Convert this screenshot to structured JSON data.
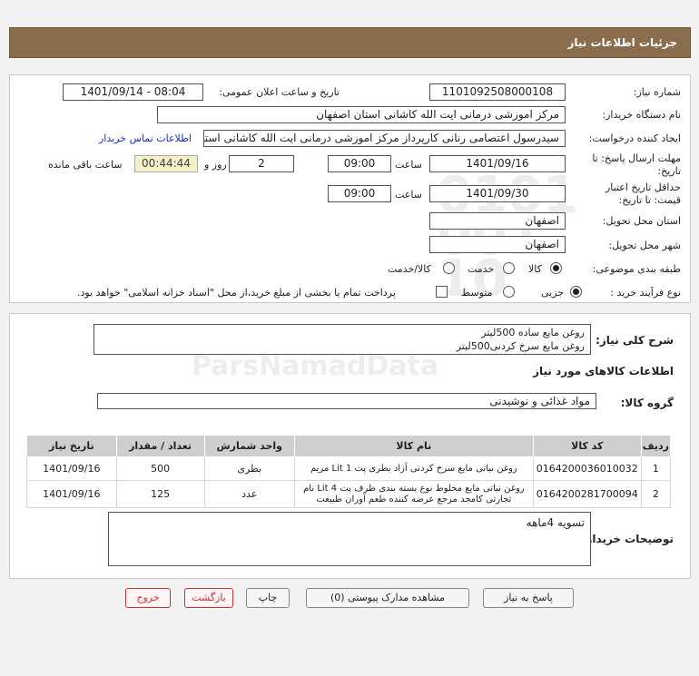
{
  "header": {
    "title": "جزئیات اطلاعات نیاز"
  },
  "form": {
    "need_number_label": "شماره نیاز:",
    "need_number": "1101092508000108",
    "announce_label": "تاریخ و ساعت اعلان عمومی:",
    "announce_value": "1401/09/14 - 08:04",
    "buyer_label": "نام دستگاه خریدار:",
    "buyer_value": "مرکز اموزشی درمانی ایت الله کاشانی استان اصفهان",
    "creator_label": "ایجاد کننده درخواست:",
    "creator_value": "سیدرسول اعتصامی رنانی کارپرداز مرکز اموزشی درمانی ایت الله کاشانی استان",
    "contact_link": "اطلاعات تماس خریدار",
    "deadline_label_1": "مهلت ارسال پاسخ: تا",
    "deadline_label_2": "تاریخ:",
    "deadline_date": "1401/09/16",
    "time_label": "ساعت",
    "deadline_time": "09:00",
    "days_value": "2",
    "days_label": "روز و",
    "remaining_time": "00:44:44",
    "remaining_label": "ساعت باقی مانده",
    "validity_label_1": "حداقل تاریخ اعتبار",
    "validity_label_2": "قیمت: تا تاریخ:",
    "validity_date": "1401/09/30",
    "validity_time": "09:00",
    "delivery_province_label": "استان محل تحویل:",
    "delivery_province": "اصفهان",
    "delivery_city_label": "شهر محل تحویل:",
    "delivery_city": "اصفهان",
    "category_label": "طبقه بندی موضوعی:",
    "category_options": [
      "کالا",
      "خدمت",
      "کالا/خدمت"
    ],
    "process_label": "نوع فرآیند خرید :",
    "process_options": [
      "جزیی",
      "متوسط"
    ],
    "payment_note": "پرداخت تمام یا بخشی از مبلغ خرید،از محل \"اسناد خزانه اسلامی\" خواهد بود."
  },
  "summary": {
    "label": "شرح کلی نیاز:",
    "lines": [
      "روغن مایع ساده 500لیتر",
      "روغن مایع سرخ کردنی500لیتر"
    ],
    "goods_info_title": "اطلاعات کالاهای مورد نیاز",
    "goods_group_label": "گروه کالا:",
    "goods_group_value": "مواد غذائی و نوشیدنی"
  },
  "table": {
    "headers": [
      "ردیف",
      "کد کالا",
      "نام کالا",
      "واحد شمارش",
      "تعداد / مقدار",
      "تاریخ نیاز"
    ],
    "rows": [
      [
        "1",
        "0164200036010032",
        "روغن نباتی مایع سرخ کردنی آزاد بطری پت 1 Lit مریم",
        "بطری",
        "500",
        "1401/09/16"
      ],
      [
        "2",
        "0164200281700094",
        "روغن نباتی مایع مخلوط نوع بسته بندی ظرف پت 4 Lit نام تجارتی کامجد مرجع عرضه کننده طعم آوران طبیعت",
        "عدد",
        "125",
        "1401/09/16"
      ]
    ]
  },
  "buyer_notes": {
    "label": "توضیحات خریدار:",
    "value": "تسویه 4ماهه"
  },
  "buttons": {
    "reply": "پاسخ به نیاز",
    "view_docs": "مشاهده مدارک پیوستی (0)",
    "print": "چاپ",
    "back": "بازگشت",
    "exit": "خروج"
  },
  "watermark": {
    "text": "ParsNamadData"
  }
}
